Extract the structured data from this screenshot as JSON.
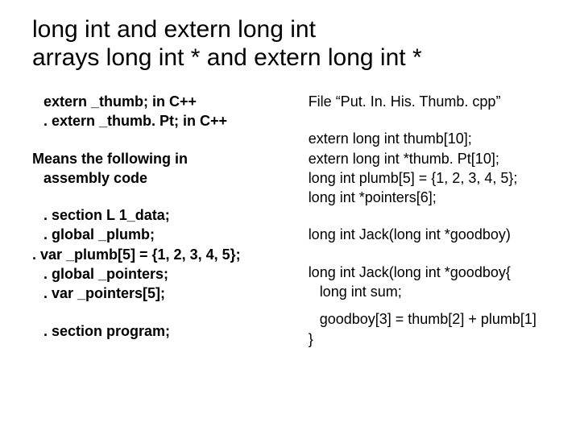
{
  "title_line1": "long int and extern long int",
  "title_line2": "arrays long int * and extern long int *",
  "left": {
    "b1l1": " extern  _thumb;    in C++",
    "b1l2": ". extern _thumb. Pt;  in C++",
    "b2l1": "Means the following in",
    "b2l2": "assembly code",
    "b3l1": ". section L 1_data;",
    "b3l2": ". global _plumb;",
    "b3l3": ". var _plumb[5] = {1, 2, 3, 4, 5};",
    "b3l4": ". global _pointers;",
    "b3l5": ". var _pointers[5];",
    "b4l1": ". section program;"
  },
  "right": {
    "b1l1": "File “Put. In. His. Thumb. cpp”",
    "b2l1": "extern long int thumb[10];",
    "b2l2": "extern long int *thumb. Pt[10];",
    "b2l3": "long int plumb[5] = {1, 2, 3, 4, 5};",
    "b2l4": "long int *pointers[6];",
    "b3l1": "long int Jack(long int *goodboy)",
    "b4l1": "long int Jack(long int *goodboy{",
    "b4l2": "long int sum;",
    "b5l1": "goodboy[3] = thumb[2] + plumb[1]",
    "b5l2": "}"
  }
}
